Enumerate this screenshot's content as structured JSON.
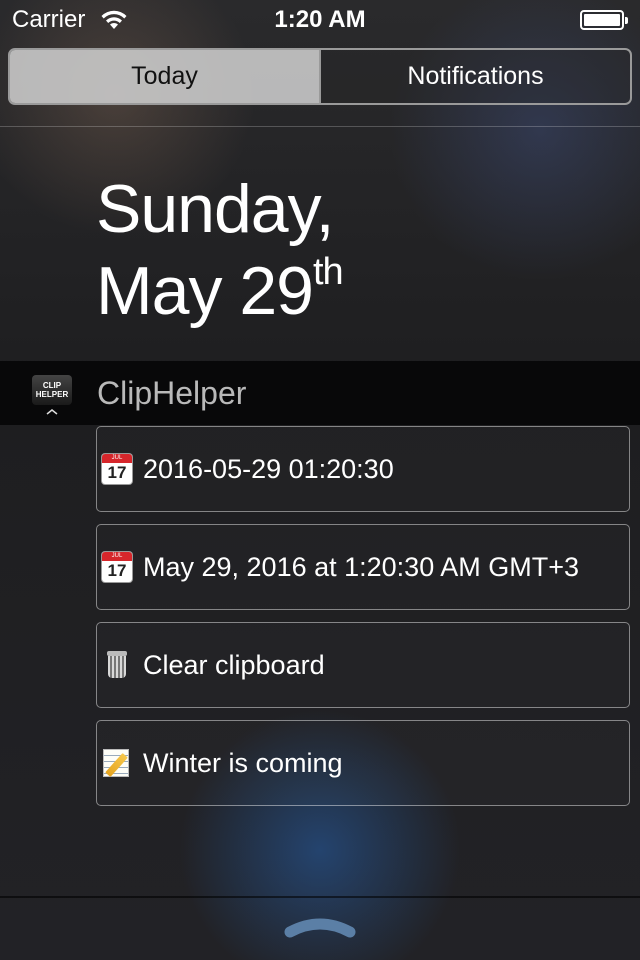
{
  "status_bar": {
    "carrier": "Carrier",
    "time": "1:20 AM",
    "wifi_icon": "wifi-icon",
    "battery_icon": "battery-icon"
  },
  "segmented": {
    "today": "Today",
    "notifications": "Notifications",
    "selected": "Today"
  },
  "date": {
    "line1": "Sunday,",
    "line2": "May 29",
    "suffix": "th"
  },
  "widget": {
    "app_name": "ClipHelper",
    "app_icon": "cliphelper-app-icon",
    "icon_text_line1": "CLIP",
    "icon_text_line2": "HELPER",
    "items": [
      {
        "icon": "calendar-icon",
        "icon_text": "JUL",
        "icon_day": "17",
        "label": "2016-05-29 01:20:30"
      },
      {
        "icon": "calendar-icon",
        "icon_text": "JUL",
        "icon_day": "17",
        "label": "May 29, 2016 at 1:20:30 AM GMT+3"
      },
      {
        "icon": "trash-icon",
        "label": "Clear clipboard"
      },
      {
        "icon": "memo-icon",
        "label": "Winter is coming"
      }
    ]
  },
  "colors": {
    "segment_active_bg": "#cdcdcd",
    "calendar_red": "#d6262b"
  },
  "bottom": {
    "grabber_icon": "chevron-up-grabber-icon"
  }
}
